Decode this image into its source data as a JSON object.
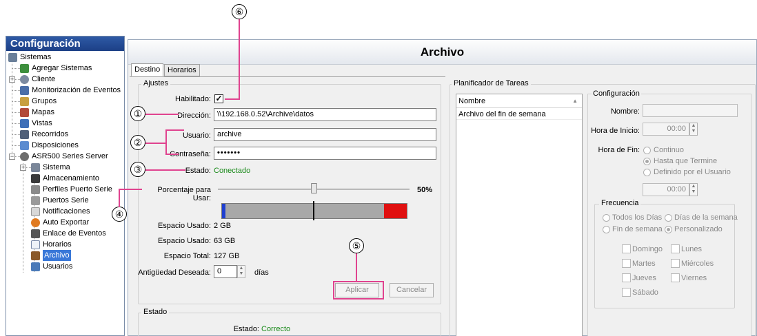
{
  "callouts": [
    "⑥",
    "①",
    "②",
    "③",
    "④",
    "⑤"
  ],
  "left_panel": {
    "title": "Configuración",
    "tree": [
      {
        "label": "Sistemas",
        "icon": "systems-icon"
      },
      {
        "label": "Agregar Sistemas",
        "icon": "add-system-icon"
      },
      {
        "label": "Cliente",
        "icon": "client-gear-icon"
      },
      {
        "label": "Monitorización de Eventos",
        "icon": "event-monitor-icon"
      },
      {
        "label": "Grupos",
        "icon": "groups-icon"
      },
      {
        "label": "Mapas",
        "icon": "maps-icon"
      },
      {
        "label": "Vistas",
        "icon": "views-icon"
      },
      {
        "label": "Recorridos",
        "icon": "tours-icon"
      },
      {
        "label": "Disposiciones",
        "icon": "layouts-icon"
      },
      {
        "label": "ASR500 Series Server",
        "icon": "server-gear-icon"
      },
      {
        "label": "Sistema",
        "icon": "system-icon"
      },
      {
        "label": "Almacenamiento",
        "icon": "storage-icon"
      },
      {
        "label": "Perfiles Puerto Serie",
        "icon": "serial-profile-icon"
      },
      {
        "label": "Puertos Serie",
        "icon": "serial-port-icon"
      },
      {
        "label": "Notificaciones",
        "icon": "notification-icon"
      },
      {
        "label": "Auto Exportar",
        "icon": "auto-export-icon"
      },
      {
        "label": "Enlace de Eventos",
        "icon": "event-link-icon"
      },
      {
        "label": "Horarios",
        "icon": "schedules-icon"
      },
      {
        "label": "Archivo",
        "icon": "archive-icon"
      },
      {
        "label": "Usuarios",
        "icon": "users-icon"
      }
    ]
  },
  "main": {
    "title": "Archivo",
    "tabs": [
      "Destino",
      "Horarios"
    ],
    "ajustes": {
      "group_title": "Ajustes",
      "habilitado_label": "Habilitado:",
      "habilitado_checked": true,
      "check_glyph": "✓",
      "direccion_label": "Dirección:",
      "direccion_value": "\\\\192.168.0.52\\Archive\\datos",
      "usuario_label": "Usuario:",
      "usuario_value": "archive",
      "contrasena_label": "Contraseña:",
      "contrasena_value": "•••••••",
      "estado_label": "Estado:",
      "estado_value": "Conectado",
      "porcentaje_label": "Porcentaje para Usar:",
      "porcentaje_value": "50%",
      "porcentaje_fraction": 0.5,
      "espacio_usado1_label": "Espacio Usado:",
      "espacio_usado1_value": "2 GB",
      "espacio_usado2_label": "Espacio Usado:",
      "espacio_usado2_value": "63 GB",
      "espacio_total_label": "Espacio Total:",
      "espacio_total_value": "127 GB",
      "antiguedad_label": "Antigüedad Deseada:",
      "antiguedad_value": "0",
      "antiguedad_unit": "días",
      "aplicar_label": "Aplicar",
      "cancelar_label": "Cancelar"
    },
    "estado_group": {
      "title": "Estado",
      "label": "Estado:",
      "value": "Correcto"
    },
    "planificador": {
      "title": "Planificador de Tareas",
      "column": "Nombre",
      "rows": [
        "Archivo del fin de semana"
      ]
    },
    "configuracion": {
      "title": "Configuración",
      "nombre_label": "Nombre:",
      "hora_inicio_label": "Hora de Inicio:",
      "hora_inicio_value": "00:00",
      "hora_fin_label": "Hora de Fin:",
      "hora_fin_options": [
        "Continuo",
        "Hasta que Termine",
        "Definido por el Usuario"
      ],
      "hora_fin_selected": "Hasta que Termine",
      "hora_fin_value": "00:00",
      "frecuencia": {
        "title": "Frecuencia",
        "options": [
          "Todos los Días",
          "Días de la semana",
          "Fin de semana",
          "Personalizado"
        ],
        "selected": "Personalizado",
        "days": [
          "Domingo",
          "Lunes",
          "Martes",
          "Miércoles",
          "Jueves",
          "Viernes",
          "Sábado"
        ]
      }
    }
  },
  "colors": {
    "callout_line": "#e0438f",
    "status_green": "#1a8a1a",
    "selection_blue": "#3a78d8",
    "bar_used_blue": "#1f3fd0",
    "bar_used_red": "#e01010"
  }
}
